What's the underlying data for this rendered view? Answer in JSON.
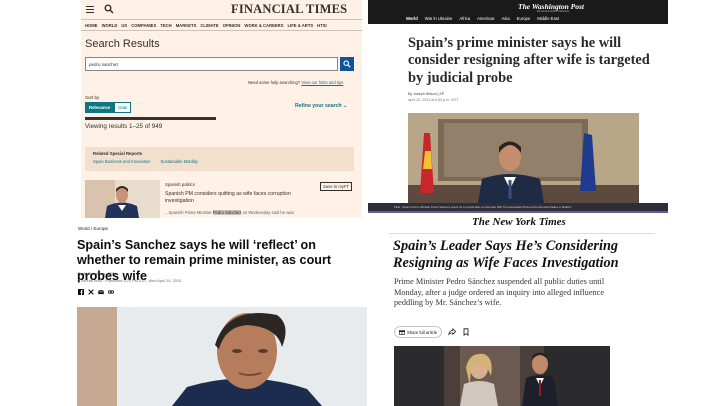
{
  "ft": {
    "logo": "FINANCIAL TIMES",
    "nav": [
      "HOME",
      "WORLD",
      "US",
      "COMPANIES",
      "TECH",
      "MARKETS",
      "CLIMATE",
      "OPINION",
      "WORK & CAREERS",
      "LIFE & ARTS",
      "HTSI"
    ],
    "page_title": "Search Results",
    "search_value": "pedro sanchez",
    "help_text": "Need some help searching?",
    "help_link": "View our hints and tips",
    "sort_label": "Sort by",
    "sort_options": [
      "Relevance",
      "Date"
    ],
    "refine_label": "Refine your search",
    "viewing": "Viewing results 1–25 of 949",
    "related_title": "Related Special Reports",
    "related_tags": [
      "Spain Business and Innovation",
      "Sustainable Mobility"
    ],
    "result": {
      "category": "Spanish politics",
      "headline": "Spanish PM considers quitting as wife faces corruption investigation",
      "snippet_pre": "...Spanish Prime Minister ",
      "snippet_mark": "Pedro Sánchez",
      "snippet_post": " on Wednesday said he was",
      "save_label": "Save to myFT"
    },
    "colors": {
      "background": "#fff1e5",
      "accent": "#0d7680",
      "button": "#0f5499"
    }
  },
  "wapo": {
    "logo": "The Washington Post",
    "tagline": "Democracy Dies in Darkness",
    "nav": [
      "World",
      "War in Ukraine",
      "Africa",
      "Americas",
      "Asia",
      "Europe",
      "Middle East"
    ],
    "headline": "Spain’s prime minister says he will consider resigning after wife is targeted by judicial probe",
    "byline": "By Joseph Wilson | AP",
    "date": "April 24, 2024 at 6:53 p.m. EDT",
    "caption": "FILE - Spain's Prime Minister Pedro Sanchez poses for a portrait after an interview with The Associated Press at the Moncloa Palace in Madrid..."
  },
  "cnn": {
    "breadcrumb": [
      "World",
      "Europe"
    ],
    "headline": "Spain’s Sanchez says he will ‘reflect’ on whether to remain prime minister, as court probes wife",
    "byline": "By Al Goodman, CNN",
    "updated": "3 minute read · Published 5:20 PM EDT, Wed April 24, 2024",
    "share_icons": [
      "facebook-icon",
      "x-icon",
      "email-icon",
      "link-icon"
    ]
  },
  "nyt": {
    "logo": "The New York Times",
    "headline": "Spain’s Leader Says He’s Considering Resigning as Wife Faces Investigation",
    "dek": "Prime Minister Pedro Sánchez suspended all public duties until Monday, after a judge ordered an inquiry into alleged influence peddling by Mr. Sánchez’s wife.",
    "share_label": "Share full article",
    "icons": [
      "gift-icon",
      "share-icon",
      "bookmark-icon"
    ]
  }
}
